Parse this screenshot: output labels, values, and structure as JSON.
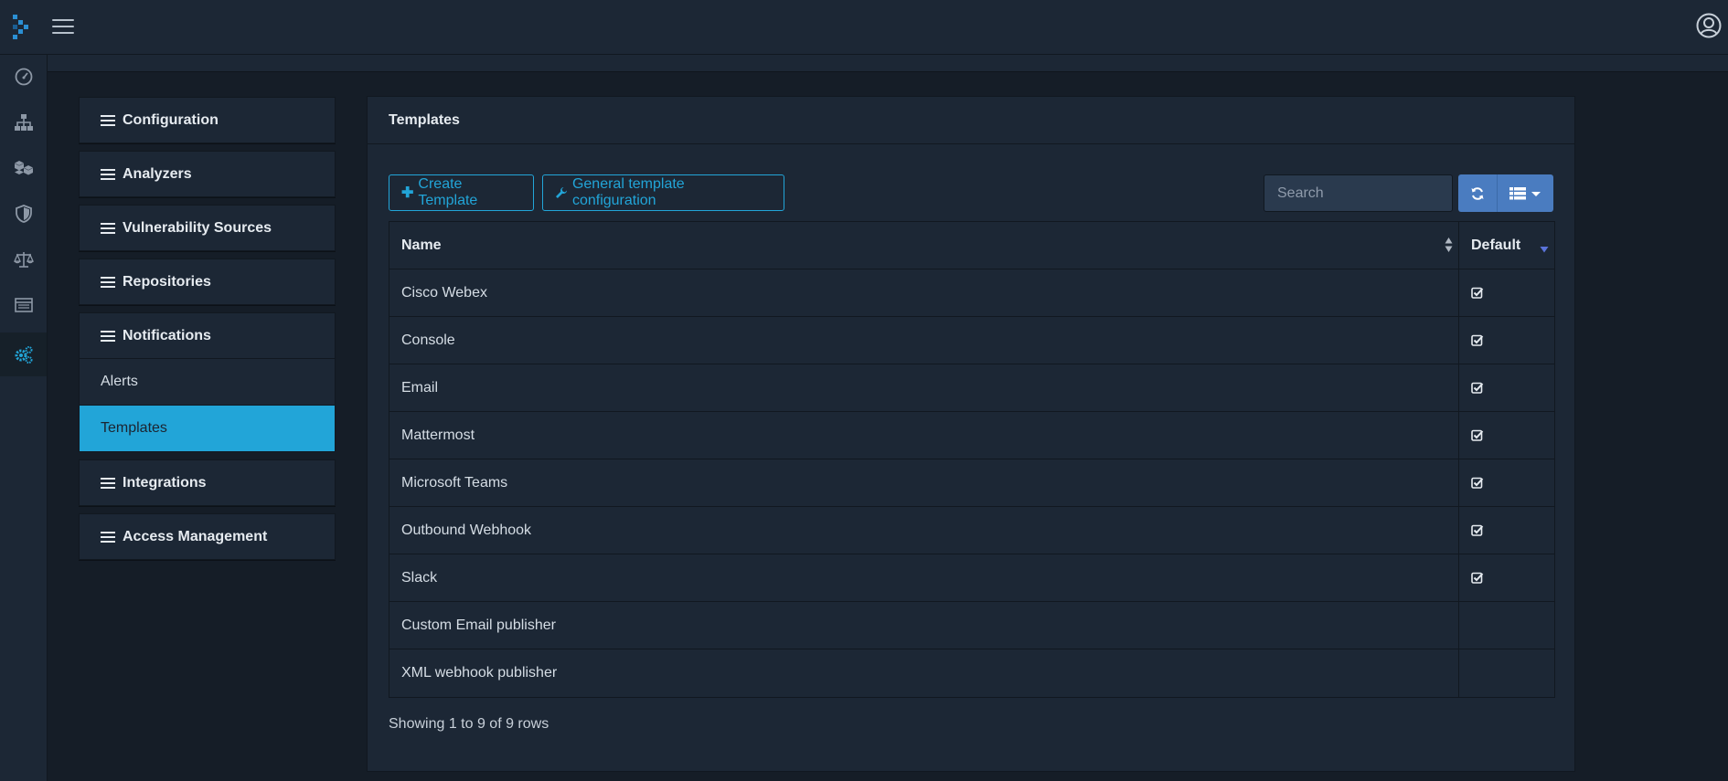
{
  "colors": {
    "accent": "#22a5d8",
    "button_blue": "#4a7cc0",
    "background": "#151d27",
    "panel": "#1c2735"
  },
  "topbar": {
    "logo_icon": "dependency-track-logo-icon",
    "menu_icon": "hamburger-icon",
    "user_icon": "user-circle-icon"
  },
  "rail": {
    "items": [
      {
        "icon": "dashboard-gauge-icon"
      },
      {
        "icon": "sitemap-icon"
      },
      {
        "icon": "cubes-icon"
      },
      {
        "icon": "shield-icon"
      },
      {
        "icon": "balance-scale-icon"
      },
      {
        "icon": "list-table-icon"
      },
      {
        "icon": "cogs-icon",
        "active": true
      }
    ]
  },
  "menu": {
    "groups": [
      {
        "label": "Configuration"
      },
      {
        "label": "Analyzers"
      },
      {
        "label": "Vulnerability Sources"
      },
      {
        "label": "Repositories"
      },
      {
        "label": "Notifications"
      },
      {
        "label": "Integrations"
      },
      {
        "label": "Access Management"
      }
    ],
    "notifications_items": [
      {
        "label": "Alerts",
        "active": false
      },
      {
        "label": "Templates",
        "active": true
      }
    ]
  },
  "card": {
    "title": "Templates",
    "create_button": "Create Template",
    "config_button": "General template configuration",
    "search_placeholder": "Search",
    "columns": {
      "name": "Name",
      "default": "Default"
    },
    "rows": [
      {
        "name": "Cisco Webex",
        "default": true
      },
      {
        "name": "Console",
        "default": true
      },
      {
        "name": "Email",
        "default": true
      },
      {
        "name": "Mattermost",
        "default": true
      },
      {
        "name": "Microsoft Teams",
        "default": true
      },
      {
        "name": "Outbound Webhook",
        "default": true
      },
      {
        "name": "Slack",
        "default": true
      },
      {
        "name": "Custom Email publisher",
        "default": false
      },
      {
        "name": "XML webhook publisher",
        "default": false
      }
    ],
    "footer": "Showing 1 to 9 of 9 rows"
  }
}
